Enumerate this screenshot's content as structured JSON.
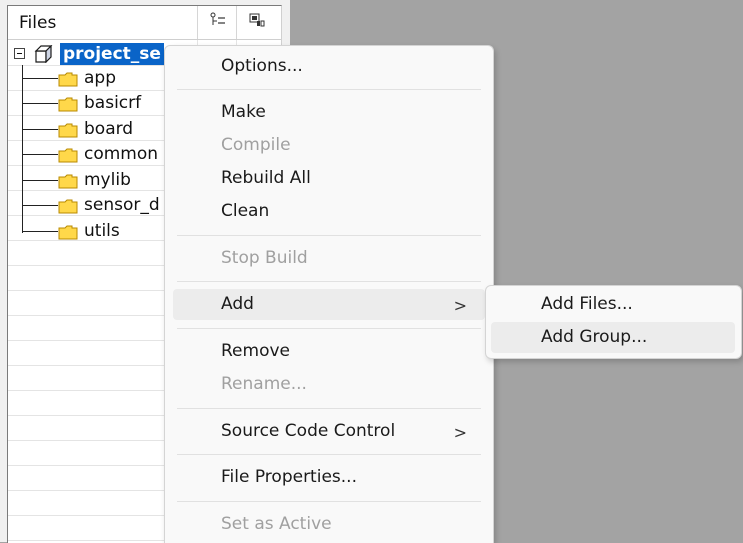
{
  "workspace": {
    "header_title": "Files",
    "column_icons": [
      "dependency-icon",
      "options-icon"
    ],
    "tree": {
      "root": "project_se",
      "folders": [
        "app",
        "basicrf",
        "board",
        "common",
        "mylib",
        "sensor_d",
        "utils"
      ]
    }
  },
  "context_menu": {
    "options": "Options...",
    "make": "Make",
    "compile": "Compile",
    "rebuild_all": "Rebuild All",
    "clean": "Clean",
    "stop_build": "Stop Build",
    "add": "Add",
    "remove": "Remove",
    "rename": "Rename...",
    "source_code_control": "Source Code Control",
    "file_properties": "File Properties...",
    "set_as_active": "Set as Active",
    "submenu_arrow": ">"
  },
  "add_submenu": {
    "add_files": "Add Files...",
    "add_group": "Add Group..."
  },
  "colors": {
    "selection": "#0a64c8",
    "background": "#a3a3a3",
    "menu_background": "#f9f9f9",
    "disabled_text": "#a0a0a0",
    "folder": "#ffd84a"
  }
}
